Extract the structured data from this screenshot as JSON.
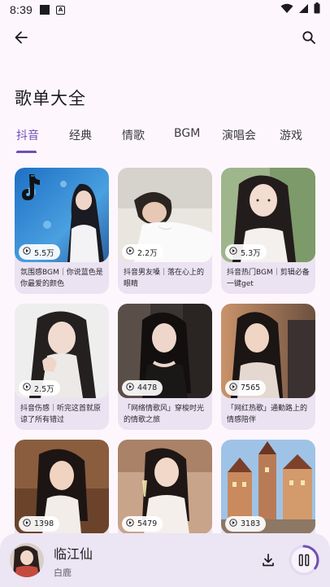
{
  "status": {
    "time": "8:39",
    "notif_letter": "A"
  },
  "header": {
    "title": "歌单大全"
  },
  "tabs": [
    {
      "label": "抖音",
      "active": true
    },
    {
      "label": "经典",
      "active": false
    },
    {
      "label": "情歌",
      "active": false
    },
    {
      "label": "BGM",
      "active": false
    },
    {
      "label": "演唱会",
      "active": false
    },
    {
      "label": "游戏",
      "active": false
    }
  ],
  "playlists": [
    {
      "plays": "5.5万",
      "title": "氛围感BGM｜你说蓝色是你最爱的颜色"
    },
    {
      "plays": "2.2万",
      "title": "抖音男友嗓｜落在心上的眼睛"
    },
    {
      "plays": "5.3万",
      "title": "抖音热门BGM｜剪辑必备一键get"
    },
    {
      "plays": "2.5万",
      "title": "抖音伤感｜听完这首就原谅了所有错过"
    },
    {
      "plays": "4478",
      "title": "「网络情歌风」穿梭时光的情歌之旅"
    },
    {
      "plays": "7565",
      "title": "「网红热歌」通勤路上的情感陪伴"
    },
    {
      "plays": "1398",
      "title": ""
    },
    {
      "plays": "5479",
      "title": ""
    },
    {
      "plays": "3183",
      "title": ""
    }
  ],
  "player": {
    "song": "临江仙",
    "artist": "白鹿",
    "progress": 0.35
  },
  "colors": {
    "accent": "#6f4fb6",
    "background": "#fdf7fd",
    "card": "#ebe3f1",
    "player": "#ece5f3"
  }
}
